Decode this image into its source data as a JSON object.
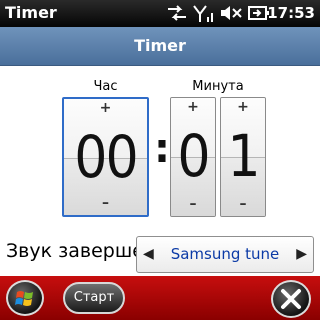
{
  "status_bar": {
    "app_title": "Timer",
    "time": "17:53"
  },
  "header": {
    "title": "Timer"
  },
  "timer": {
    "hours_label": "Час",
    "minutes_label": "Минута",
    "hours_value": "00",
    "minutes_tens": "0",
    "minutes_ones": "1",
    "plus": "+",
    "minus": "–",
    "separator": ":"
  },
  "sound": {
    "label": "Звук заверше",
    "value": "Samsung tune"
  },
  "bottom_bar": {
    "start_label": "Старт"
  },
  "colors": {
    "accent": "#4a6f9b",
    "softkey_bar": "#b00000",
    "selected_border": "#2f6cc8",
    "link": "#0b3aa6"
  }
}
